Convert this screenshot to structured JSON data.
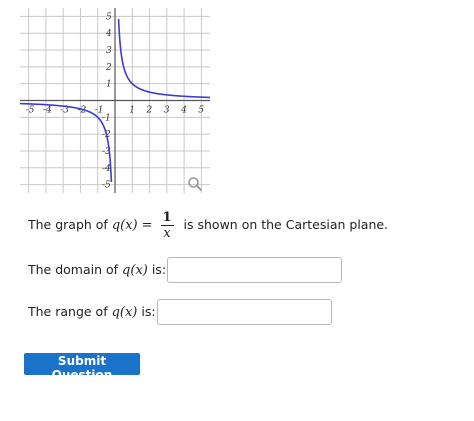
{
  "graph": {
    "function": "q(x) = 1/x",
    "x_ticks": [
      "-5",
      "-4",
      "-3",
      "-2",
      "-1",
      "1",
      "2",
      "3",
      "4",
      "5"
    ],
    "y_ticks": [
      "5",
      "4",
      "3",
      "2",
      "1",
      "-1",
      "-2",
      "-3",
      "-4",
      "-5"
    ],
    "xlim": [
      -5.5,
      5.5
    ],
    "ylim": [
      -5.5,
      5.5
    ],
    "grid": true,
    "curve_color": "#3c3cd0",
    "zoom_icon": "magnifier-icon"
  },
  "question": {
    "prefix": "The graph of",
    "function_name": "q(x)",
    "equals": "=",
    "numerator": "1",
    "denominator": "x",
    "suffix": "is shown on the Cartesian plane."
  },
  "domain_prompt": {
    "prefix": "The domain of",
    "function_name": "q(x)",
    "suffix": "is:"
  },
  "range_prompt": {
    "prefix": "The range of",
    "function_name": "q(x)",
    "suffix": "is:"
  },
  "submit": {
    "label": "Submit Question",
    "color": "#1a73c9"
  }
}
